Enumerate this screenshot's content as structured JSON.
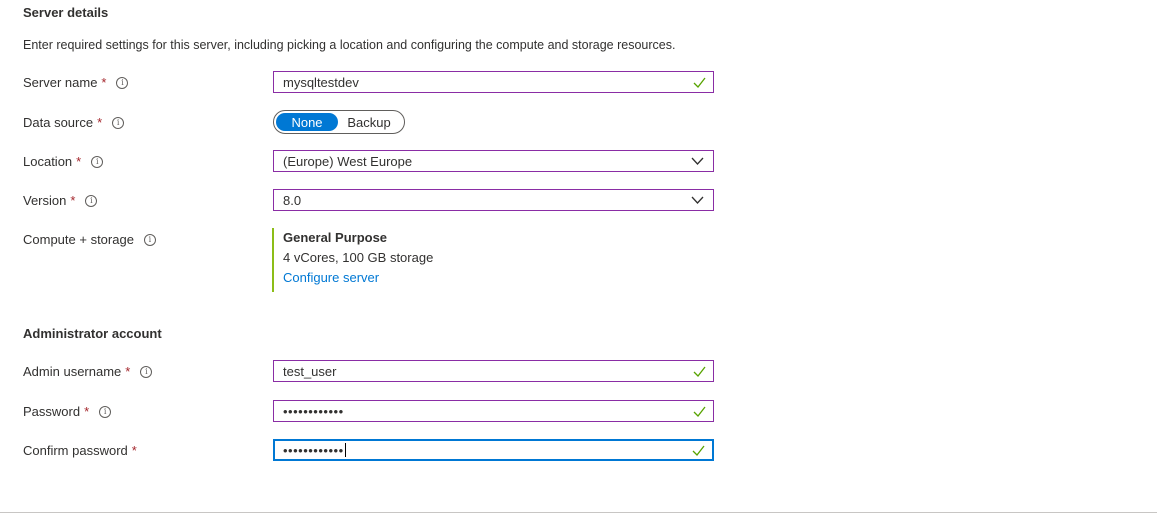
{
  "server_details": {
    "title": "Server details",
    "description": "Enter required settings for this server, including picking a location and configuring the compute and storage resources."
  },
  "fields": {
    "server_name": {
      "label": "Server name",
      "required": "*",
      "value": "mysqltestdev"
    },
    "data_source": {
      "label": "Data source",
      "required": "*",
      "options": [
        "None",
        "Backup"
      ],
      "selected": "None"
    },
    "location": {
      "label": "Location",
      "required": "*",
      "value": "(Europe) West Europe"
    },
    "version": {
      "label": "Version",
      "required": "*",
      "value": "8.0"
    },
    "compute_storage": {
      "label": "Compute + storage",
      "tier": "General Purpose",
      "spec": "4 vCores, 100 GB storage",
      "link": "Configure server"
    }
  },
  "admin_account": {
    "title": "Administrator account",
    "admin_username": {
      "label": "Admin username",
      "required": "*",
      "value": "test_user"
    },
    "password": {
      "label": "Password",
      "required": "*",
      "value": "••••••••••••"
    },
    "confirm_password": {
      "label": "Confirm password",
      "required": "*",
      "value": "••••••••••••"
    }
  },
  "icons": {
    "info": "info-icon",
    "valid": "checkmark-icon",
    "dropdown": "chevron-down-icon"
  },
  "colors": {
    "accent": "#0078d4",
    "valid": "#57a300",
    "field_border": "#8a2da5",
    "required": "#a4262c",
    "compute_bar": "#8cbd18"
  }
}
